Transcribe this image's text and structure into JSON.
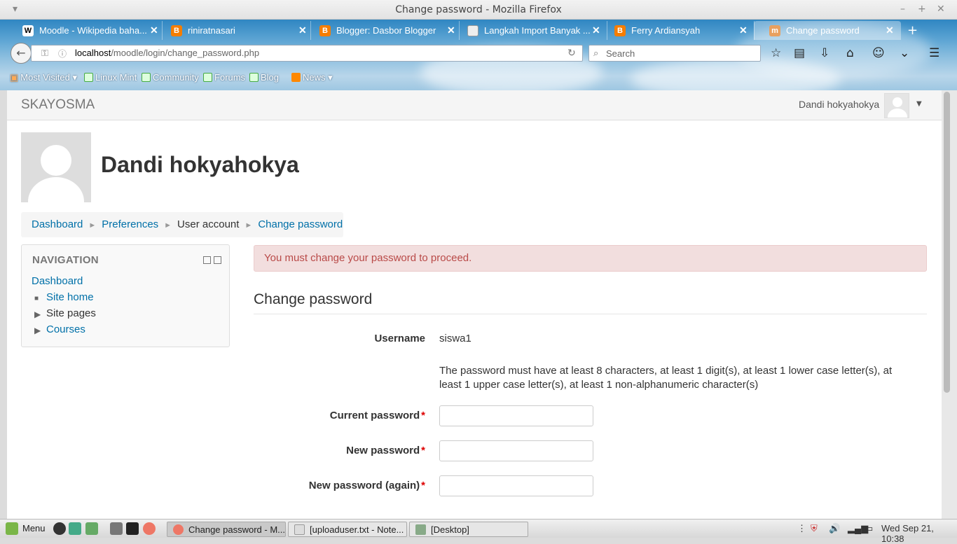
{
  "window": {
    "title": "Change password - Mozilla Firefox"
  },
  "tabs": [
    {
      "label": "Moodle - Wikipedia baha...",
      "icon": "W"
    },
    {
      "label": "riniratnasari",
      "icon": "B"
    },
    {
      "label": "Blogger: Dasbor Blogger",
      "icon": "B"
    },
    {
      "label": "Langkah Import Banyak ...",
      "icon": ""
    },
    {
      "label": "Ferry Ardiansyah",
      "icon": "B"
    },
    {
      "label": "Change password",
      "icon": ""
    }
  ],
  "url": {
    "host": "localhost",
    "path": "/moodle/login/change_password.php"
  },
  "search": {
    "placeholder": "Search"
  },
  "bookmarks": [
    "Most Visited",
    "Linux Mint",
    "Community",
    "Forums",
    "Blog",
    "News"
  ],
  "site": {
    "brand": "SKAYOSMA",
    "user": "Dandi hokyahokya"
  },
  "page_heading": "Dandi hokyahokya",
  "breadcrumb": [
    "Dashboard",
    "Preferences",
    "User account",
    "Change password"
  ],
  "navigation": {
    "title": "NAVIGATION",
    "items": [
      "Dashboard",
      "Site home",
      "Site pages",
      "Courses"
    ]
  },
  "alert": "You must change your password to proceed.",
  "form": {
    "title": "Change password",
    "username_label": "Username",
    "username_value": "siswa1",
    "policy": "The password must have at least 8 characters, at least 1 digit(s), at least 1 lower case letter(s), at least 1 upper case letter(s), at least 1 non-alphanumeric character(s)",
    "current_label": "Current password",
    "new_label": "New password",
    "again_label": "New password (again)",
    "required_mark": "*"
  },
  "taskbar": {
    "menu": "Menu",
    "windows": [
      "Change password - M...",
      "[uploaduser.txt - Note...",
      "[Desktop]"
    ],
    "clock": "Wed Sep 21, 10:38"
  },
  "colors": {
    "link": "#0070a8",
    "alert_bg": "#f2dede",
    "alert_text": "#b94a48",
    "required": "#dd0000"
  }
}
